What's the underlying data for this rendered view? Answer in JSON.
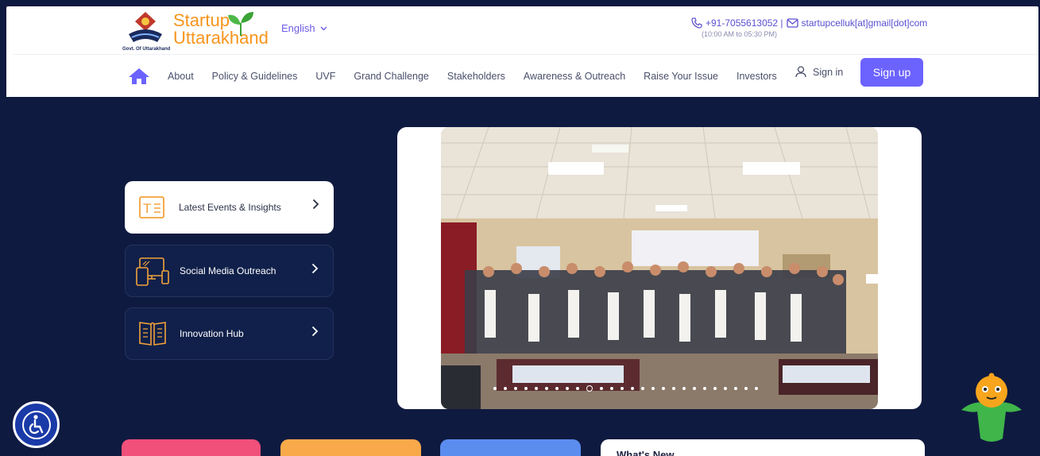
{
  "header": {
    "emblem_caption": "Govt. Of Uttarakhand",
    "brand_line1": "Startup",
    "brand_line2": "Uttarakhand",
    "language": "English",
    "phone": "+91-7055613052 |",
    "email": "startupcelluk[at]gmail[dot]com",
    "hours": "(10:00 AM to 05:30 PM)"
  },
  "nav": {
    "items": [
      "About",
      "Policy & Guidelines",
      "UVF",
      "Grand Challenge",
      "Stakeholders",
      "Awareness & Outreach",
      "Raise Your Issue",
      "Investors"
    ],
    "signin": "Sign in",
    "signup": "Sign up"
  },
  "menu_cards": [
    {
      "label": "Latest Events & Insights",
      "icon": "events-icon",
      "active": true
    },
    {
      "label": "Social Media Outreach",
      "icon": "devices-icon",
      "active": false
    },
    {
      "label": "Innovation Hub",
      "icon": "book-icon",
      "active": false
    }
  ],
  "carousel": {
    "slide_count": 26,
    "active_index": 9
  },
  "bottom": {
    "whats_new_title": "What's New"
  },
  "colors": {
    "background": "#0f1a40",
    "accent": "#6c63ff",
    "brand_orange": "#f7941d",
    "tile_pink": "#f0507a",
    "tile_orange": "#f9a94a",
    "tile_blue": "#5b8def"
  },
  "icons": {
    "home": "home-icon",
    "phone": "phone-icon",
    "email": "mail-icon",
    "user": "user-icon",
    "accessibility": "accessibility-icon",
    "chatbot": "chatbot-icon"
  }
}
